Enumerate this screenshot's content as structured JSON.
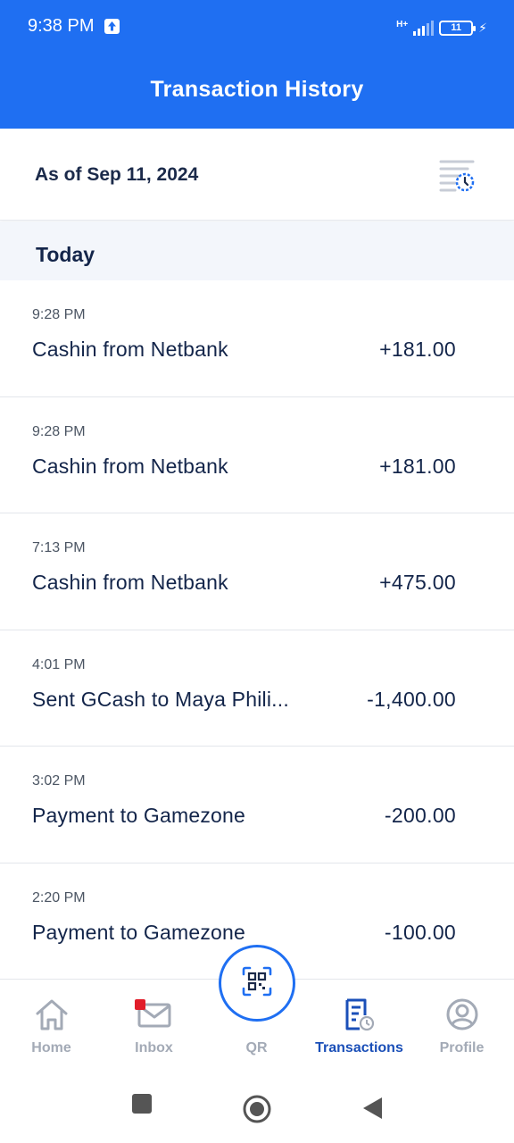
{
  "status_bar": {
    "time": "9:38 PM",
    "network": "H+",
    "battery": "11"
  },
  "header": {
    "title": "Transaction History"
  },
  "as_of": {
    "label": "As of Sep 11, 2024",
    "icon": "transaction-history-icon"
  },
  "section": {
    "title": "Today"
  },
  "transactions": [
    {
      "time": "9:28 PM",
      "description": "Cashin from Netbank",
      "amount": "+181.00"
    },
    {
      "time": "9:28 PM",
      "description": "Cashin from Netbank",
      "amount": "+181.00"
    },
    {
      "time": "7:13 PM",
      "description": "Cashin from Netbank",
      "amount": "+475.00"
    },
    {
      "time": "4:01 PM",
      "description": "Sent GCash to Maya Phili...",
      "amount": "-1,400.00"
    },
    {
      "time": "3:02 PM",
      "description": "Payment to Gamezone",
      "amount": "-200.00"
    },
    {
      "time": "2:20 PM",
      "description": "Payment to Gamezone",
      "amount": "-100.00"
    }
  ],
  "bottom_nav": {
    "items": [
      {
        "label": "Home",
        "icon": "home-icon",
        "active": false
      },
      {
        "label": "Inbox",
        "icon": "mail-icon",
        "active": false
      },
      {
        "label": "QR",
        "icon": "qr-scan-icon",
        "active": false
      },
      {
        "label": "Transactions",
        "icon": "receipt-icon",
        "active": true
      },
      {
        "label": "Profile",
        "icon": "user-icon",
        "active": false
      }
    ]
  },
  "colors": {
    "primary": "#1f6ff2",
    "text_dark": "#13254a",
    "nav_inactive": "#a3aab6",
    "nav_active": "#1a4fb8",
    "notification": "#e11d2a"
  }
}
